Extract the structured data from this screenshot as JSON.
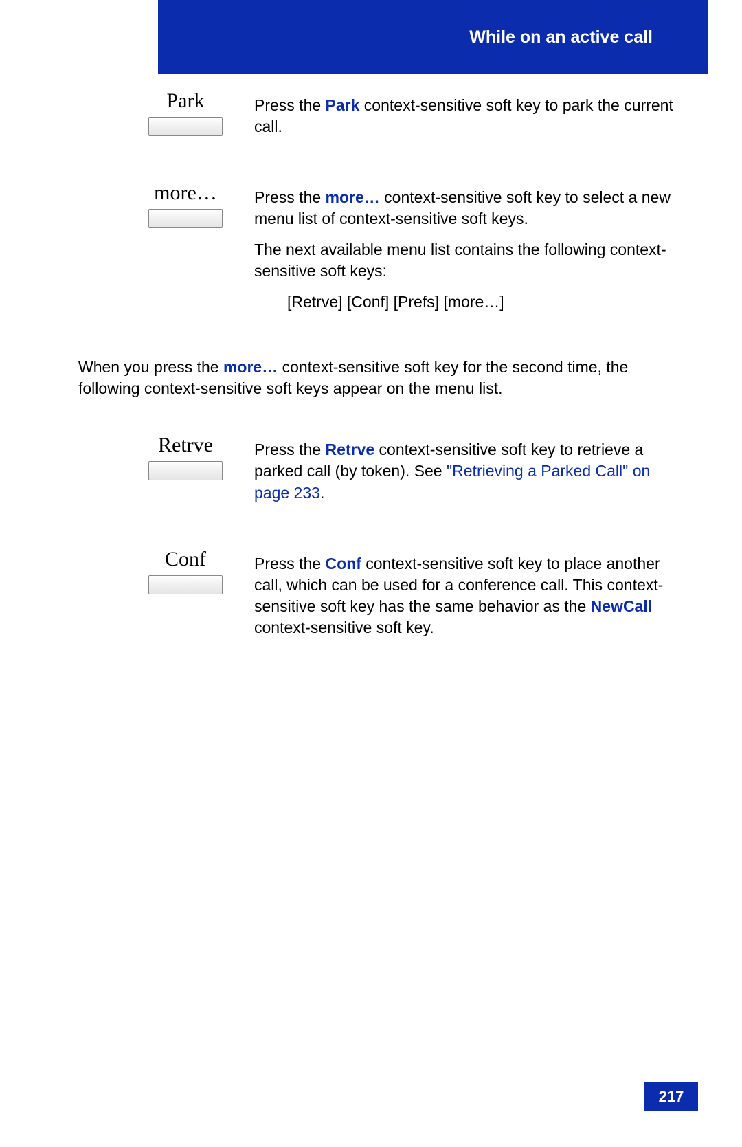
{
  "header": {
    "title": "While on an active call"
  },
  "page_number": "217",
  "sections": {
    "park": {
      "label": "Park",
      "desc_pre": "Press the ",
      "desc_key": "Park",
      "desc_post": " context-sensitive soft key to park the current call."
    },
    "more": {
      "label": "more…",
      "p1_pre": "Press the ",
      "p1_key": "more…",
      "p1_post": " context-sensitive soft key to select a new menu list of context-sensitive soft keys.",
      "p2": "The next available menu list contains the following context-sensitive soft keys:",
      "p3": "[Retrve] [Conf] [Prefs] [more…]"
    },
    "mid": {
      "pre": "When you press the ",
      "key": "more…",
      "post": " context-sensitive soft key for the second time, the following context-sensitive soft keys appear on the menu list."
    },
    "retrve": {
      "label": "Retrve",
      "p1_pre": "Press the ",
      "p1_key": "Retrve",
      "p1_post": " context-sensitive soft key to retrieve a parked call (by token). See ",
      "p1_link": "\"Retrieving a Parked Call\" on page 233",
      "p1_end": "."
    },
    "conf": {
      "label": "Conf",
      "p1_pre": "Press the ",
      "p1_key": "Conf",
      "p1_post": " context-sensitive soft key to place another call, which can be used for a conference call. This context-sensitive soft key has the same behavior as the ",
      "p1_key2": "NewCall",
      "p1_end": " context-sensitive soft key."
    }
  }
}
